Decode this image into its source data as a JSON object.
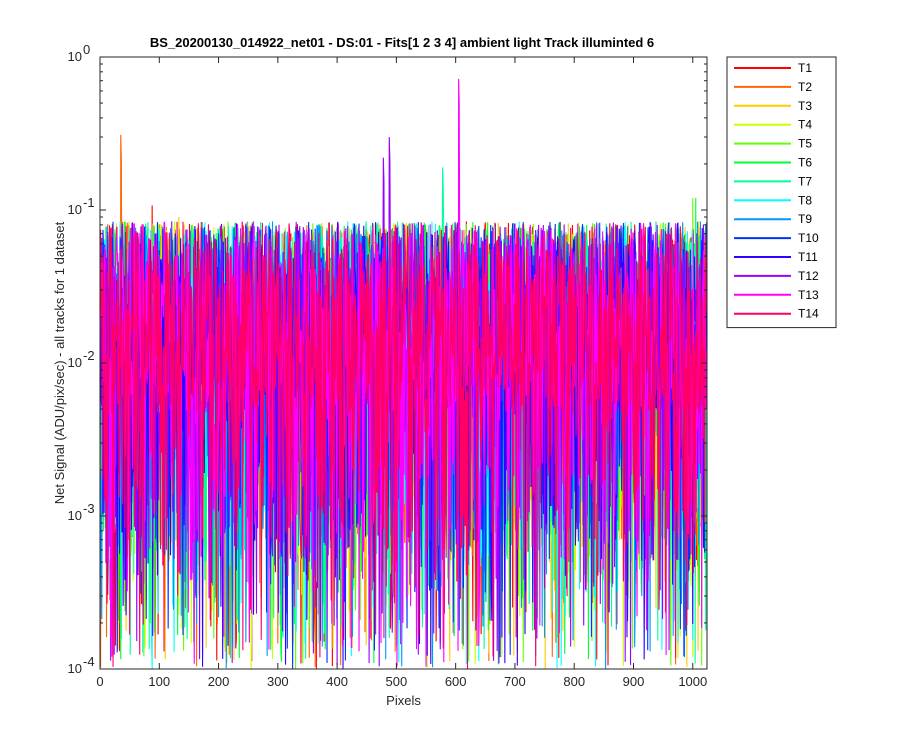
{
  "chart_data": {
    "type": "line",
    "title": "BS_20200130_014922_net01 - DS:01 - Fits[1  2  3  4]   ambient light   Track illuminted 6",
    "xlabel": "Pixels",
    "ylabel": "Net Signal (ADU/pix/sec) - all tracks for 1 dataset",
    "xlim": [
      0,
      1024
    ],
    "ylim": [
      0.0001,
      1
    ],
    "yscale": "log",
    "xticks": [
      0,
      100,
      200,
      300,
      400,
      500,
      600,
      700,
      800,
      900,
      1000
    ],
    "yticks": [
      {
        "value": 0.0001,
        "base": "10",
        "exp": "-4"
      },
      {
        "value": 0.001,
        "base": "10",
        "exp": "-3"
      },
      {
        "value": 0.01,
        "base": "10",
        "exp": "-2"
      },
      {
        "value": 0.1,
        "base": "10",
        "exp": "-1"
      },
      {
        "value": 1,
        "base": "10",
        "exp": "0"
      }
    ],
    "grid": false,
    "legend_position": "outside-top-right",
    "series": [
      {
        "name": "T1",
        "color": "#ff0000",
        "approx_median": 0.02,
        "peaks": [
          [
            88,
            0.107
          ]
        ]
      },
      {
        "name": "T2",
        "color": "#ff6600",
        "approx_median": 0.02,
        "peaks": [
          [
            35,
            0.31
          ]
        ]
      },
      {
        "name": "T3",
        "color": "#ffcc00",
        "approx_median": 0.02,
        "peaks": [
          [
            133,
            0.09
          ]
        ]
      },
      {
        "name": "T4",
        "color": "#ccff00",
        "approx_median": 0.02,
        "peaks": [
          [
            255,
            0.0001
          ]
        ]
      },
      {
        "name": "T5",
        "color": "#66ff00",
        "approx_median": 0.02,
        "peaks": [
          [
            1000,
            0.12
          ]
        ]
      },
      {
        "name": "T6",
        "color": "#00ff33",
        "approx_median": 0.02,
        "peaks": [
          [
            1005,
            0.12
          ]
        ]
      },
      {
        "name": "T7",
        "color": "#00ff99",
        "approx_median": 0.02,
        "peaks": [
          [
            578,
            0.19
          ]
        ]
      },
      {
        "name": "T8",
        "color": "#00ffff",
        "approx_median": 0.02,
        "peaks": [
          [
            88,
            0.0001
          ]
        ]
      },
      {
        "name": "T9",
        "color": "#0099ff",
        "approx_median": 0.02,
        "peaks": [
          [
            853,
            0.0001
          ]
        ]
      },
      {
        "name": "T10",
        "color": "#0033ff",
        "approx_median": 0.02,
        "peaks": [
          [
            325,
            0.0001
          ]
        ]
      },
      {
        "name": "T11",
        "color": "#3300ff",
        "approx_median": 0.02,
        "peaks": [
          [
            410,
            0.0001
          ]
        ]
      },
      {
        "name": "T12",
        "color": "#9900ff",
        "approx_median": 0.02,
        "peaks": [
          [
            478,
            0.22
          ],
          [
            488,
            0.3
          ]
        ]
      },
      {
        "name": "T13",
        "color": "#ff00ff",
        "approx_median": 0.02,
        "peaks": [
          [
            605,
            0.72
          ]
        ]
      },
      {
        "name": "T14",
        "color": "#ff0066",
        "approx_median": 0.02,
        "peaks": [
          [
            620,
            0.0001
          ]
        ]
      }
    ]
  }
}
